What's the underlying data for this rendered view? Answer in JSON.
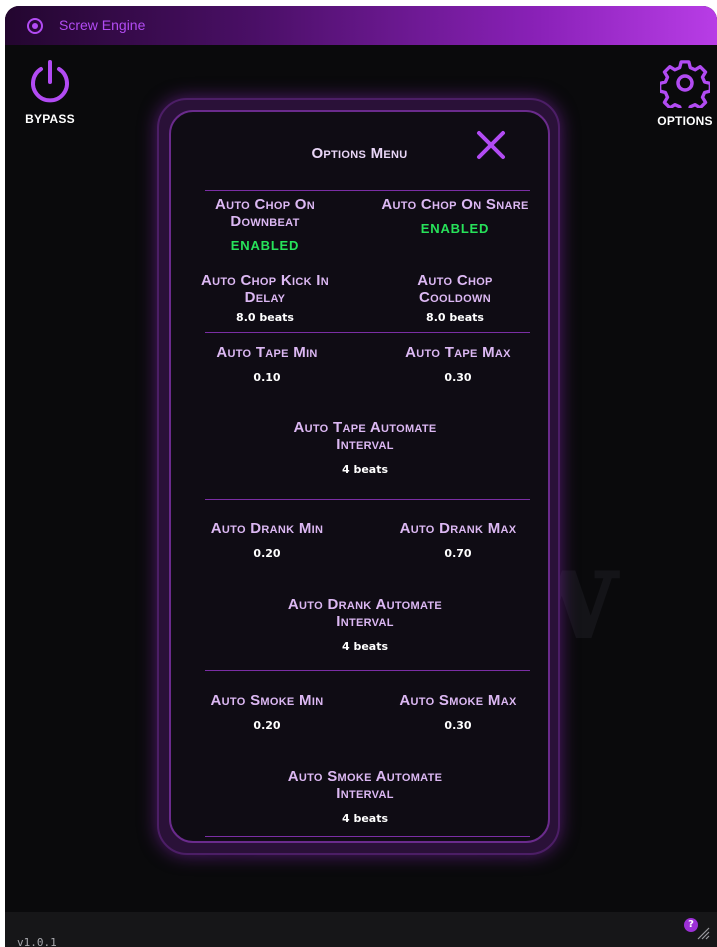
{
  "app": {
    "title": "Screw Engine"
  },
  "header": {
    "bypass_label": "BYPASS",
    "options_label": "OPTIONS"
  },
  "modal": {
    "heading": "Options Menu",
    "options": {
      "chop_downbeat": {
        "label": "Auto Chop On Downbeat",
        "value": "ENABLED"
      },
      "chop_snare": {
        "label": "Auto Chop On Snare",
        "value": "ENABLED"
      },
      "chop_kick_delay": {
        "label": "Auto Chop Kick In Delay",
        "value": "8.0 beats"
      },
      "chop_cooldown": {
        "label": "Auto Chop Cooldown",
        "value": "8.0 beats"
      },
      "tape_min": {
        "label": "Auto Tape Min",
        "value": "0.10"
      },
      "tape_max": {
        "label": "Auto Tape Max",
        "value": "0.30"
      },
      "tape_interval": {
        "label": "Auto Tape Automate Interval",
        "value": "4 beats"
      },
      "drank_min": {
        "label": "Auto Drank Min",
        "value": "0.20"
      },
      "drank_max": {
        "label": "Auto Drank Max",
        "value": "0.70"
      },
      "drank_interval": {
        "label": "Auto Drank Automate Interval",
        "value": "4 beats"
      },
      "smoke_min": {
        "label": "Auto Smoke Min",
        "value": "0.20"
      },
      "smoke_max": {
        "label": "Auto Smoke Max",
        "value": "0.30"
      },
      "smoke_interval": {
        "label": "Auto Smoke Automate Interval",
        "value": "4 beats"
      }
    }
  },
  "footer": {
    "version": "v1.0.1",
    "help_label": "?"
  },
  "icons": {
    "app": "record-icon",
    "bypass": "power-icon",
    "options": "gear-icon",
    "close": "close-icon",
    "help": "help-icon",
    "resize": "resize-grip-icon"
  },
  "colors": {
    "accent": "#b24bf3",
    "label": "#dcb8f3",
    "enabled": "#27e25a",
    "background": "#0a0a0c"
  }
}
